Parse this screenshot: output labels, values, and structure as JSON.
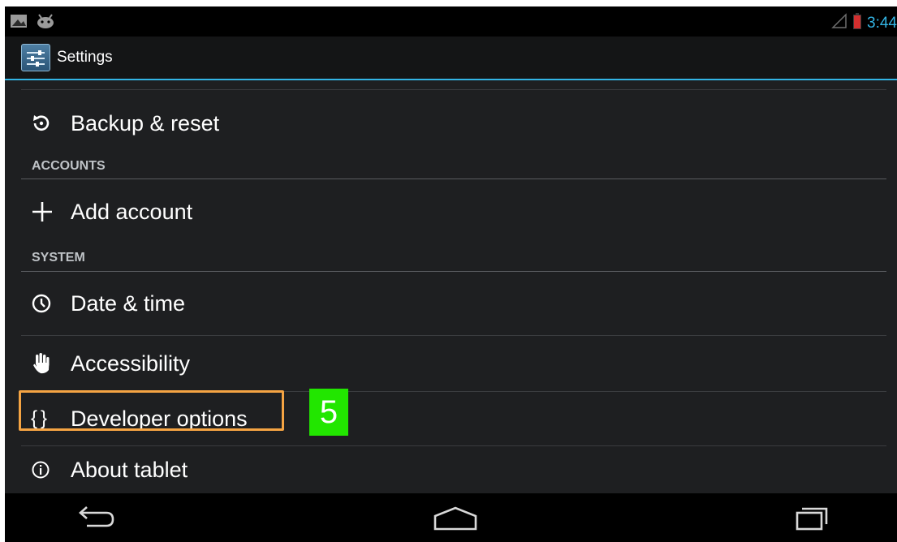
{
  "status_bar": {
    "time": "3:44",
    "colors": {
      "clock": "#33b5e5",
      "battery_low": "#d32f2f"
    },
    "icons": [
      "screenshot-icon",
      "android-icon",
      "signal-icon",
      "battery-icon"
    ]
  },
  "action_bar": {
    "title": "Settings",
    "icon": "settings-app-icon",
    "accent": "#33b5e5"
  },
  "list": {
    "items": [
      {
        "label": "Backup & reset",
        "icon": "backup-restore-icon"
      },
      {
        "header": "ACCOUNTS"
      },
      {
        "label": "Add account",
        "icon": "plus-icon"
      },
      {
        "header": "SYSTEM"
      },
      {
        "label": "Date & time",
        "icon": "clock-icon"
      },
      {
        "label": "Accessibility",
        "icon": "hand-icon"
      },
      {
        "label": "Developer options",
        "icon": "braces-icon"
      },
      {
        "label": "About tablet",
        "icon": "info-icon"
      }
    ]
  },
  "annotation": {
    "step_number": "5",
    "highlight_color": "#f5a443",
    "badge_color": "#22e600"
  },
  "nav_bar": {
    "buttons": [
      "back-icon",
      "home-icon",
      "recent-apps-icon"
    ]
  }
}
